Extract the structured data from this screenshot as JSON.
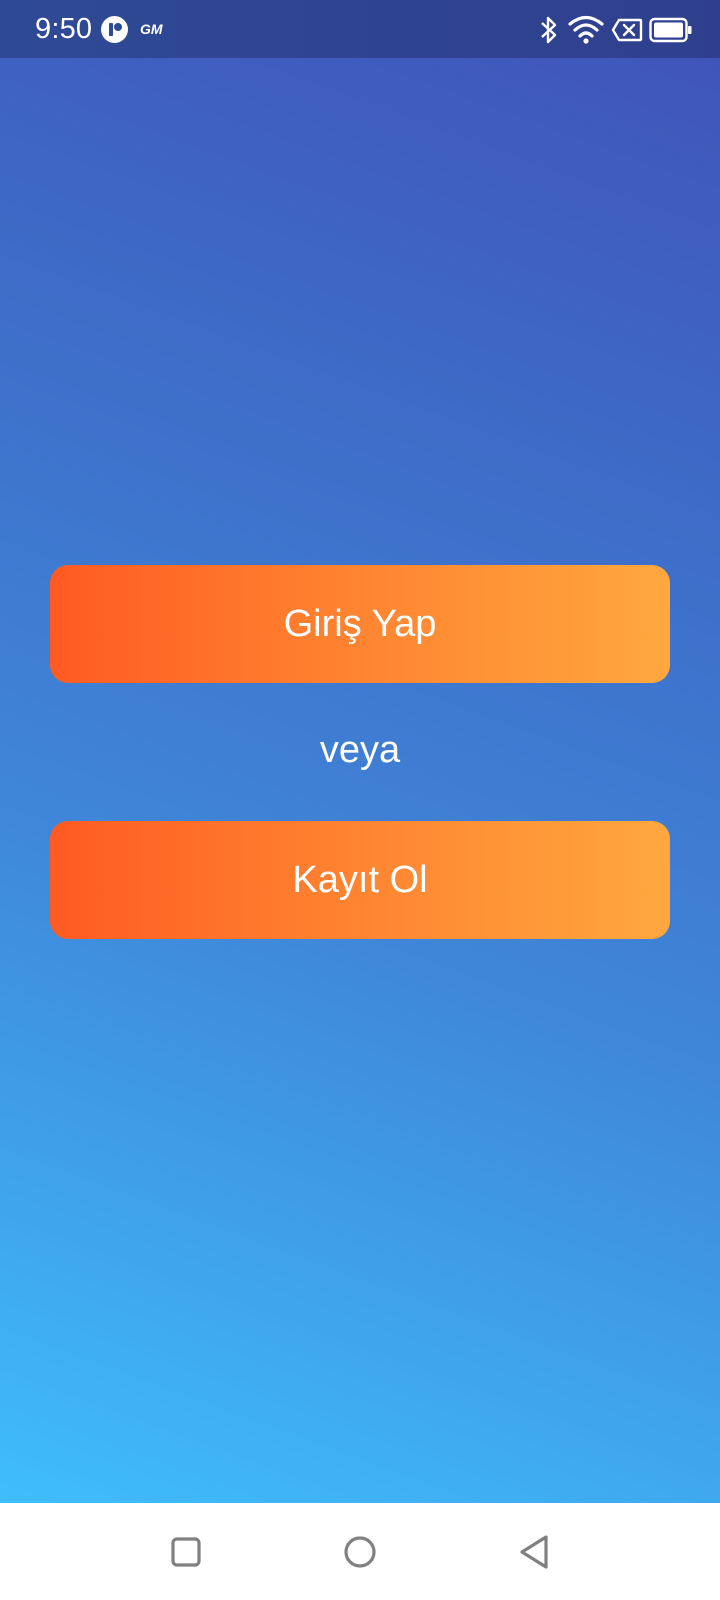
{
  "status_bar": {
    "time": "9:50",
    "left_icons": [
      "app-notification-icon",
      "gm-icon"
    ],
    "gm_label": "GM",
    "right_icons": [
      "bluetooth-icon",
      "wifi-icon",
      "no-sim-icon",
      "battery-icon"
    ]
  },
  "main": {
    "login_button_label": "Giriş Yap",
    "or_label": "veya",
    "register_button_label": "Kayıt Ol"
  },
  "nav_bar": {
    "icons": [
      "recent-apps-icon",
      "home-icon",
      "back-icon"
    ]
  },
  "colors": {
    "background_top": "#4052b8",
    "background_bottom": "#3fbdfc",
    "button_start": "#ff5a22",
    "button_end": "#ffa83f",
    "status_bar": "#2f4a95",
    "nav_bar": "#ffffff",
    "nav_icon": "#808080"
  }
}
